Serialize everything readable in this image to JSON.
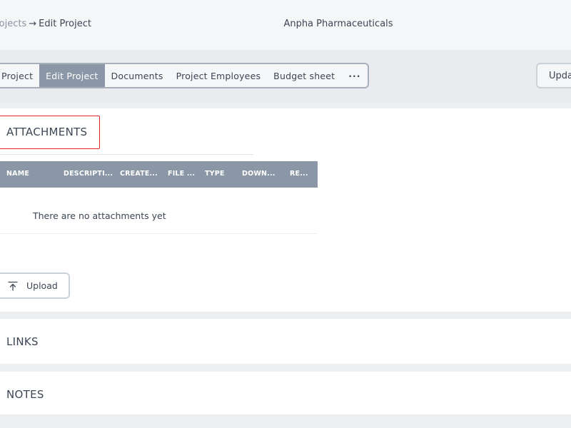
{
  "header": {
    "breadcrumb_parent": "Projects",
    "breadcrumb_current": "Edit Project",
    "company": "Anpha Pharmaceuticals"
  },
  "tabs": {
    "items": [
      {
        "label": "Project"
      },
      {
        "label": "Edit Project"
      },
      {
        "label": "Documents"
      },
      {
        "label": "Project Employees"
      },
      {
        "label": "Budget sheet"
      },
      {
        "label": "···"
      }
    ],
    "active_index": 1
  },
  "toolbar": {
    "update_label": "Update"
  },
  "attachments": {
    "title": "ATTACHMENTS",
    "columns": [
      "NAME",
      "DESCRIPTI...",
      "CREATE...",
      "FILE ...",
      "TYPE",
      "DOWN...",
      "RE..."
    ],
    "empty_message": "There are no attachments yet",
    "upload_label": "Upload",
    "upload_icon": "upload-icon"
  },
  "links": {
    "title": "LINKS"
  },
  "notes": {
    "title": "NOTES"
  },
  "colors": {
    "accent": "#8b97a6",
    "highlight": "#e02424",
    "background": "#eceef1"
  }
}
